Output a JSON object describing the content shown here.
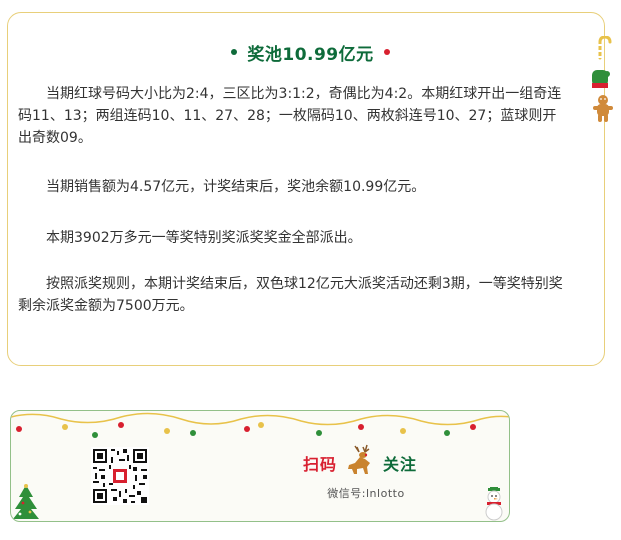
{
  "article": {
    "title": "奖池10.99亿元",
    "paragraphs": [
      "当期红球号码大小比为2:4，三区比为3:1:2，奇偶比为4:2。本期红球开出一组奇连码11、13；两组连码10、11、27、28；一枚隔码10、两枚斜连号10、27；蓝球则开出奇数09。",
      "当期销售额为4.57亿元，计奖结束后，奖池余额10.99亿元。",
      "本期3902万多元一等奖特别奖派奖奖金全部派出。",
      "按照派奖规则，本期计奖结束后，双色球12亿元大派奖活动还剩3期，一等奖特别奖剩余派奖金额为7500万元。"
    ]
  },
  "footer": {
    "scan_label": "扫码",
    "follow_label": "关注",
    "wechat_id": "微信号:lnlotto"
  },
  "colors": {
    "title_green": "#0e6b3a",
    "accent_red": "#d8202f",
    "card_border": "#e8cf7a",
    "footer_border": "#93c089"
  },
  "icons": [
    "candy-cane-icon",
    "mitten-icon",
    "gingerbread-icon",
    "reindeer-icon",
    "christmas-tree-icon",
    "snowman-icon",
    "qr-code-icon"
  ]
}
